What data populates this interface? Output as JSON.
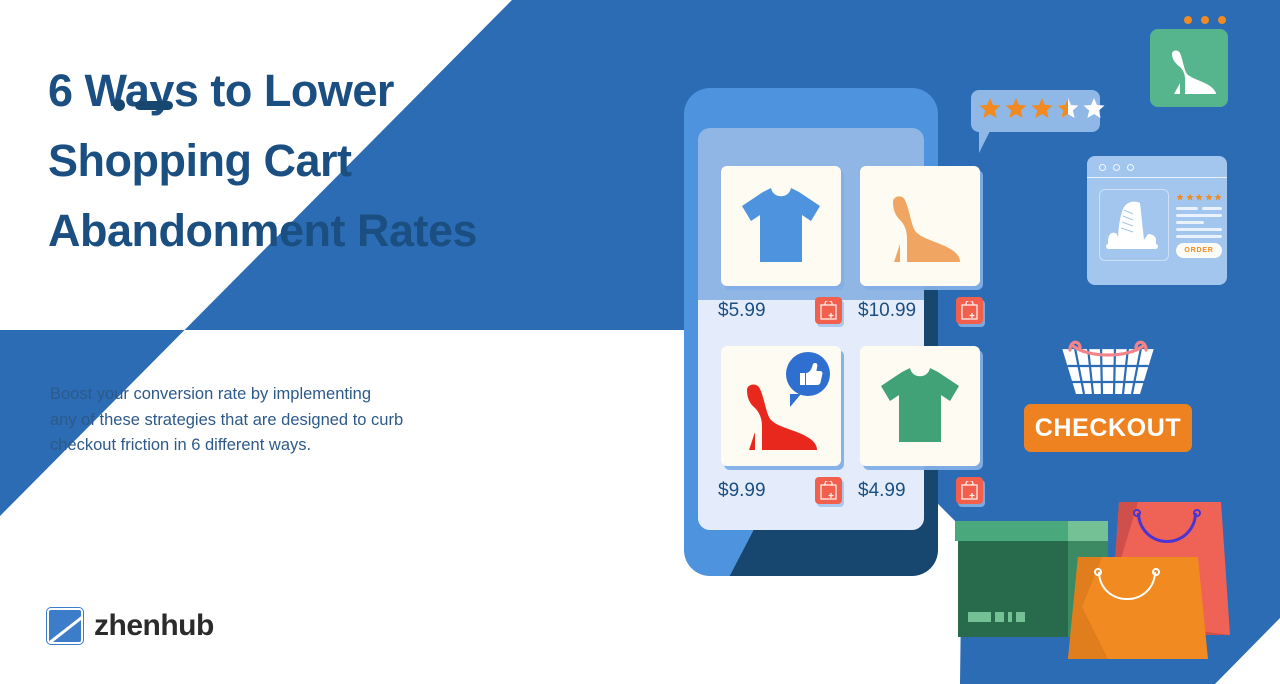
{
  "colors": {
    "background_blue": "#2c6cb4",
    "headline_navy": "#1b4f82",
    "accent_orange": "#ef8220",
    "cart_coral": "#f2604d",
    "box_green": "#276b4c",
    "bag_red": "#ef6256",
    "white": "#ffffff"
  },
  "headline": {
    "line1": "6 Ways to Lower",
    "line2": "Shopping Cart",
    "line3": "Abandonment Rates"
  },
  "subcopy": {
    "line1": "Boost your conversion rate by implementing",
    "line2": "any of these strategies that are designed to curb",
    "line3": "checkout friction in 6 different ways."
  },
  "logo": {
    "text": "zhenhub",
    "mark_icon": "zhenhub-square-logo-icon"
  },
  "phone": {
    "products": [
      {
        "icon": "tshirt-blue-icon",
        "price": "$5.99",
        "cart_icon": "add-to-cart-icon"
      },
      {
        "icon": "high-heel-orange-icon",
        "price": "$10.99",
        "cart_icon": "add-to-cart-icon"
      },
      {
        "icon": "high-heel-red-icon",
        "price": "$9.99",
        "cart_icon": "add-to-cart-icon",
        "badge": "thumbs-up-icon"
      },
      {
        "icon": "tshirt-green-icon",
        "price": "$4.99",
        "cart_icon": "add-to-cart-icon"
      }
    ],
    "camera_icon": "phone-camera-icon",
    "speaker_icon": "phone-speaker-icon"
  },
  "rating_bubble": {
    "icon": "star-rating-icon",
    "value": 3.5,
    "max": 5,
    "filled_color": "#f08a21",
    "empty_color": "#ffffff"
  },
  "shoe_card": {
    "icon": "white-high-heel-icon",
    "dots_icon": "three-dots-icon",
    "dot_count": 3
  },
  "browser_window": {
    "product_icon": "sneaker-icon",
    "stars_icon": "five-star-rating-icon",
    "star_count": 5,
    "order_button_label": "ORDER",
    "window_dots_icon": "window-controls-icon"
  },
  "checkout": {
    "basket_icon": "shopping-basket-icon",
    "button_label": "CHECKOUT"
  },
  "bags": {
    "box_icon": "cardboard-box-icon",
    "red_bag_icon": "shopping-bag-red-icon",
    "orange_bag_icon": "shopping-bag-orange-icon"
  }
}
